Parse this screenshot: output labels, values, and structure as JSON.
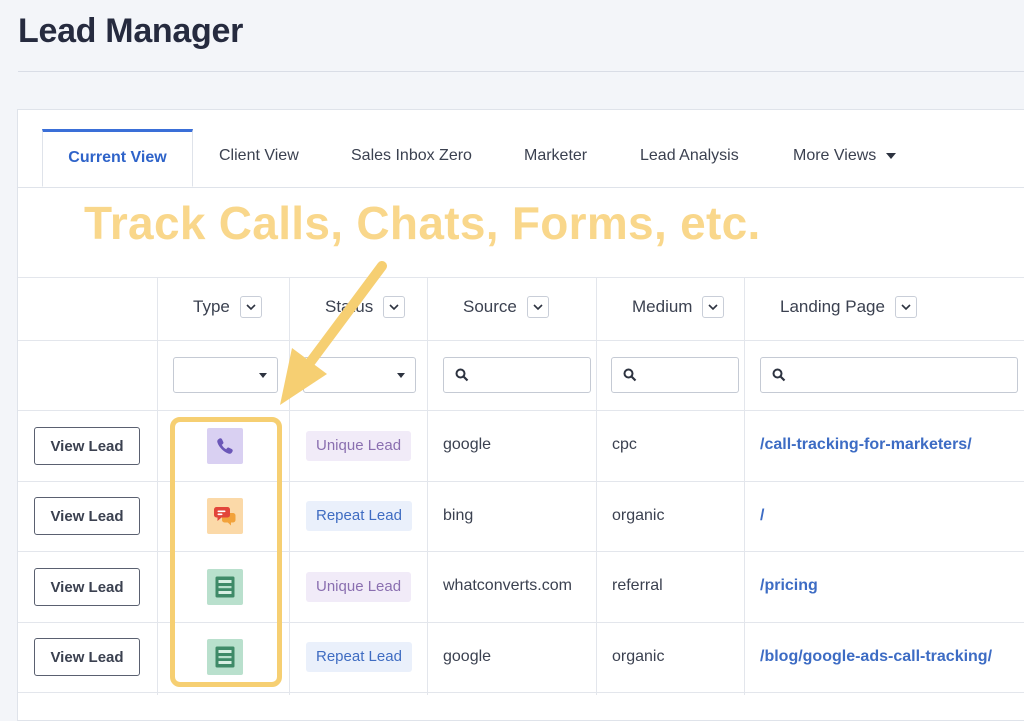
{
  "page_title": "Lead Manager",
  "tabs": [
    {
      "label": "Current View"
    },
    {
      "label": "Client View"
    },
    {
      "label": "Sales Inbox Zero"
    },
    {
      "label": "Marketer"
    },
    {
      "label": "Lead Analysis"
    },
    {
      "label": "More Views"
    }
  ],
  "callout": "Track Calls, Chats, Forms, etc.",
  "columns": {
    "type": "Type",
    "status": "Status",
    "source": "Source",
    "medium": "Medium",
    "landing_page": "Landing Page"
  },
  "filters": {
    "source_placeholder": "",
    "medium_placeholder": "",
    "landing_placeholder": ""
  },
  "rows": [
    {
      "action": "View Lead",
      "type_icon": "phone-icon",
      "status": "Unique Lead",
      "source": "google",
      "medium": "cpc",
      "landing_page": "/call-tracking-for-marketers/"
    },
    {
      "action": "View Lead",
      "type_icon": "chat-icon",
      "status": "Repeat Lead",
      "source": "bing",
      "medium": "organic",
      "landing_page": "/"
    },
    {
      "action": "View Lead",
      "type_icon": "form-icon",
      "status": "Unique Lead",
      "source": "whatconverts.com",
      "medium": "referral",
      "landing_page": "/pricing"
    },
    {
      "action": "View Lead",
      "type_icon": "form-icon",
      "status": "Repeat Lead",
      "source": "google",
      "medium": "organic",
      "landing_page": "/blog/google-ads-call-tracking/"
    }
  ],
  "colors": {
    "accent": "#3a6fd8",
    "callout": "#f9d78b",
    "highlight": "#f6cf72",
    "unique_badge_bg": "#f1ebf8",
    "unique_badge_text": "#8a6fb0",
    "repeat_badge_bg": "#eaf0fb",
    "repeat_badge_text": "#3f6cc2",
    "phone_icon_bg": "#d9d0f2",
    "chat_icon_bg": "#fbd9a8",
    "form_icon_bg": "#b9e0cd"
  }
}
